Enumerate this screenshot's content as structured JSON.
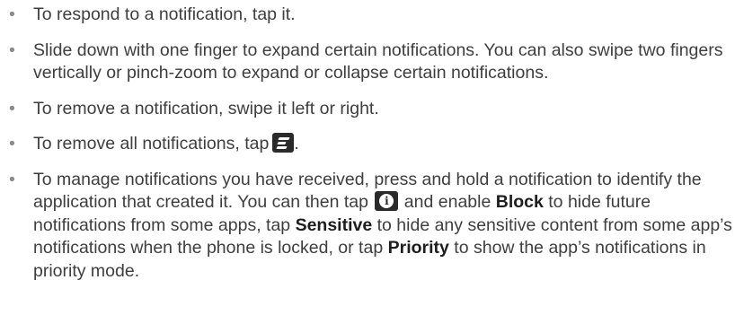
{
  "items": [
    {
      "text": "To respond to a notification, tap it."
    },
    {
      "text": "Slide down with one finger to expand certain notifications. You can also swipe two fingers vertically or pinch-zoom to expand or collapse certain notifications."
    },
    {
      "text": "To remove a notification, swipe it left or right."
    },
    {
      "before": "To remove all notifications, tap",
      "icon": "clear-all-icon",
      "after": "."
    },
    {
      "part1": "To manage notifications you have received, press and hold a notification to identify the application that created it. You can then tap",
      "icon": "info-icon",
      "part2": "and enable",
      "kw1": "Block",
      "part3": "to hide future notifications from some apps, tap",
      "kw2": "Sensitive",
      "part4": "to hide any sensitive content from some app’s notifications when the phone is locked, or tap",
      "kw3": "Priority",
      "part5": "to show the app’s notifications in priority mode."
    }
  ],
  "bullet_char": "•",
  "info_glyph": "i"
}
